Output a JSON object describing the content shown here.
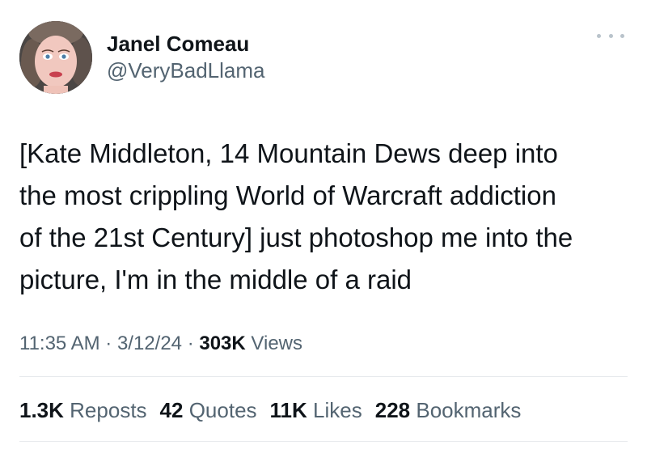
{
  "author": {
    "display_name": "Janel Comeau",
    "handle": "@VeryBadLlama"
  },
  "tweet": {
    "text": "[Kate Middleton, 14 Mountain Dews deep into\nthe most crippling World of Warcraft addiction\nof the 21st Century] just photoshop me into the\npicture, I'm in the middle of a raid"
  },
  "meta": {
    "time": "11:35 AM",
    "sep1": " · ",
    "date": "3/12/24",
    "sep2": " · ",
    "views_count": "303K",
    "views_label": "Views"
  },
  "stats": {
    "reposts_count": "1.3K",
    "reposts_label": "Reposts",
    "quotes_count": "42",
    "quotes_label": "Quotes",
    "likes_count": "11K",
    "likes_label": "Likes",
    "bookmarks_count": "228",
    "bookmarks_label": "Bookmarks"
  },
  "icons": {
    "more": "more-options-icon",
    "avatar": "avatar"
  },
  "colors": {
    "text_primary": "#0f1419",
    "text_secondary": "#536471",
    "divider": "#e6e9ec"
  }
}
